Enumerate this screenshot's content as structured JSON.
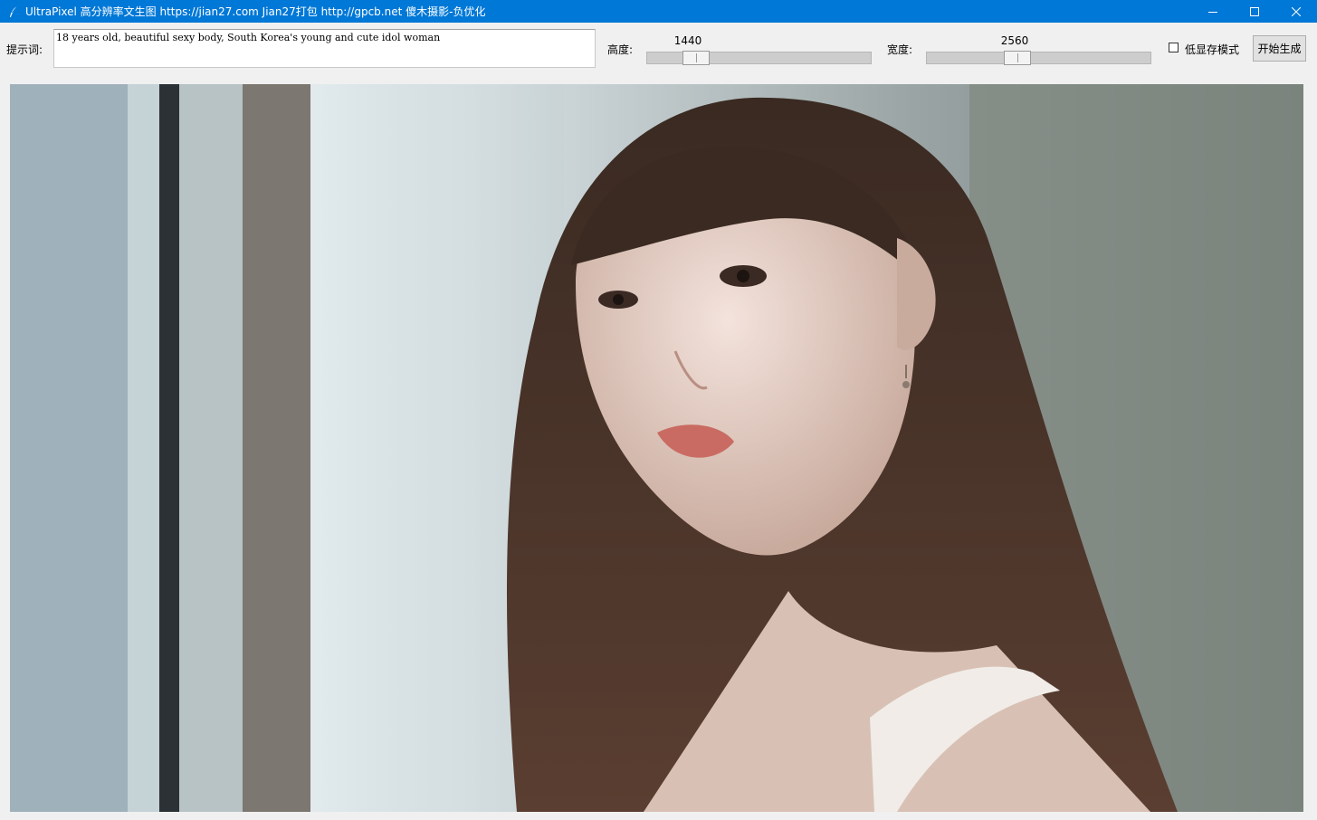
{
  "window": {
    "title": "UltraPixel 高分辨率文生图  https://jian27.com Jian27打包  http://gpcb.net 傻木摄影-负优化",
    "app_icon": "feather-icon",
    "controls": [
      "minimize-icon",
      "maximize-icon",
      "close-icon"
    ]
  },
  "toolbar": {
    "prompt_label": "提示词:",
    "prompt_value": "18 years old, beautiful sexy body, South Korea's young and cute idol woman",
    "height_label": "高度:",
    "height_value": "1440",
    "height_fraction": 0.18,
    "width_label": "宽度:",
    "width_value": "2560",
    "width_fraction": 0.39,
    "low_vram_label": "低显存模式",
    "low_vram_checked": false,
    "generate_label": "开始生成"
  },
  "colors": {
    "titlebar": "#0078d7",
    "window_bg": "#f0f0f0"
  }
}
